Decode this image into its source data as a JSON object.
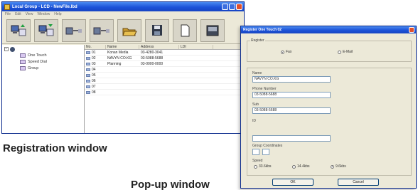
{
  "main_window": {
    "title": "Local Group - LCD - NewFile.lbd",
    "menu": [
      "File",
      "Edit",
      "View",
      "Window",
      "Help"
    ],
    "tree": {
      "items": [
        {
          "label": "One Touch"
        },
        {
          "label": "Speed Dial"
        },
        {
          "label": "Group"
        }
      ]
    },
    "list": {
      "columns": [
        "No.",
        "Name",
        "Address",
        "LDI"
      ],
      "rows": [
        {
          "no": "01",
          "name": "Konan Media",
          "address": "03-4280-3041"
        },
        {
          "no": "02",
          "name": "NAVYN CO.KG",
          "address": "03-5088-5688"
        },
        {
          "no": "03",
          "name": "Planning",
          "address": "03-0000-0000"
        },
        {
          "no": "04",
          "name": "",
          "address": ""
        },
        {
          "no": "05",
          "name": "",
          "address": ""
        },
        {
          "no": "06",
          "name": "",
          "address": ""
        },
        {
          "no": "07",
          "name": "",
          "address": ""
        },
        {
          "no": "08",
          "name": "",
          "address": ""
        }
      ]
    }
  },
  "popup": {
    "title": "Register One Touch 02",
    "register_group_label": "Register",
    "radio_fax": "Fax",
    "radio_email": "E-Mail",
    "name_label": "Name",
    "name_value": "NAVYN CO.KG",
    "phone_label": "Phone Number",
    "phone_value": "03-5088-5688",
    "sub_label": "Sub",
    "sub_value": "03-5088-5688",
    "id_label": "ID",
    "id_value": "",
    "group_label": "Group Coordinates",
    "speed_label": "Speed",
    "speed_options": [
      "33.6kbs",
      "14.4kbs",
      "9.6kbs"
    ],
    "ok_label": "OK",
    "cancel_label": "Cancel"
  },
  "captions": {
    "main": "Registration window",
    "popup": "Pop-up window"
  }
}
